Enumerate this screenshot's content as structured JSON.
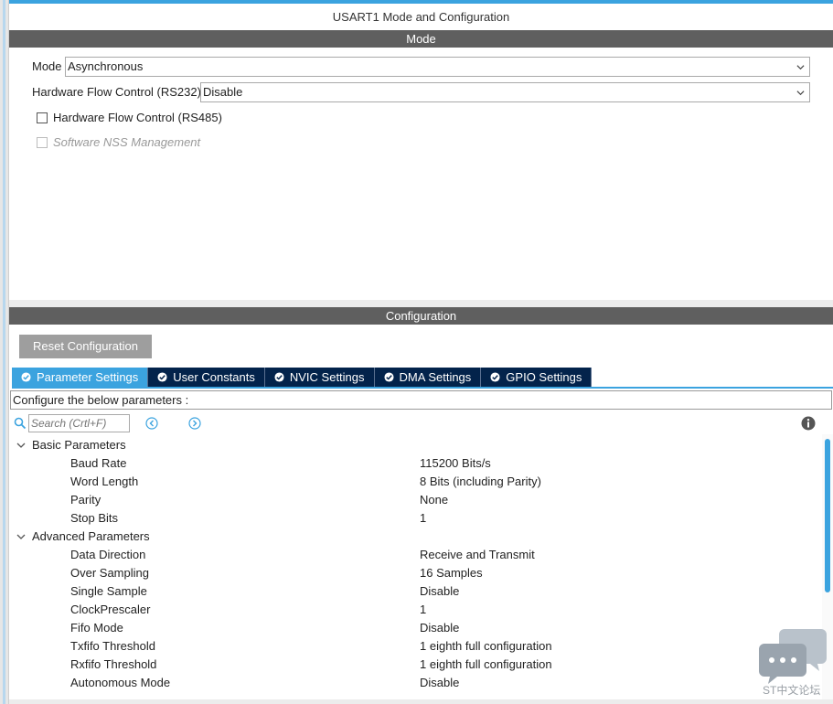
{
  "window": {
    "title": "USART1 Mode and Configuration"
  },
  "mode_section": {
    "header": "Mode",
    "mode_label": "Mode",
    "mode_value": "Asynchronous",
    "hw_flow_label": "Hardware Flow Control (RS232)",
    "hw_flow_value": "Disable",
    "rs485_label": "Hardware Flow Control (RS485)",
    "rs485_checked": false,
    "nss_label": "Software NSS Management",
    "nss_enabled": false
  },
  "config_section": {
    "header": "Configuration",
    "reset_label": "Reset Configuration",
    "tabs": [
      {
        "label": "Parameter Settings",
        "active": true
      },
      {
        "label": "User Constants",
        "active": false
      },
      {
        "label": "NVIC Settings",
        "active": false
      },
      {
        "label": "DMA Settings",
        "active": false
      },
      {
        "label": "GPIO Settings",
        "active": false
      }
    ],
    "configure_text": "Configure the below parameters :",
    "search_placeholder": "Search (Crtl+F)",
    "groups": [
      {
        "name": "Basic Parameters",
        "params": [
          {
            "name": "Baud Rate",
            "value": "115200 Bits/s"
          },
          {
            "name": "Word Length",
            "value": "8 Bits (including Parity)"
          },
          {
            "name": "Parity",
            "value": "None"
          },
          {
            "name": "Stop Bits",
            "value": "1"
          }
        ]
      },
      {
        "name": "Advanced Parameters",
        "params": [
          {
            "name": "Data Direction",
            "value": "Receive and Transmit"
          },
          {
            "name": "Over Sampling",
            "value": "16 Samples"
          },
          {
            "name": "Single Sample",
            "value": "Disable"
          },
          {
            "name": "ClockPrescaler",
            "value": "1"
          },
          {
            "name": "Fifo Mode",
            "value": "Disable"
          },
          {
            "name": "Txfifo Threshold",
            "value": "1 eighth full configuration"
          },
          {
            "name": "Rxfifo Threshold",
            "value": "1 eighth full configuration"
          },
          {
            "name": "Autonomous Mode",
            "value": "Disable"
          }
        ]
      }
    ]
  },
  "watermark": {
    "text": "ST中文论坛"
  },
  "colors": {
    "accent": "#3ba3df",
    "tab_dark": "#03234b",
    "header_gray": "#5f5f5f",
    "button_gray": "#9e9e9e"
  },
  "icons": {
    "search": "search-icon",
    "prev": "prev-arrow-icon",
    "next": "next-arrow-icon",
    "info": "info-icon",
    "expand": "chevron-down-icon",
    "tab_ok": "check-circle-icon"
  }
}
